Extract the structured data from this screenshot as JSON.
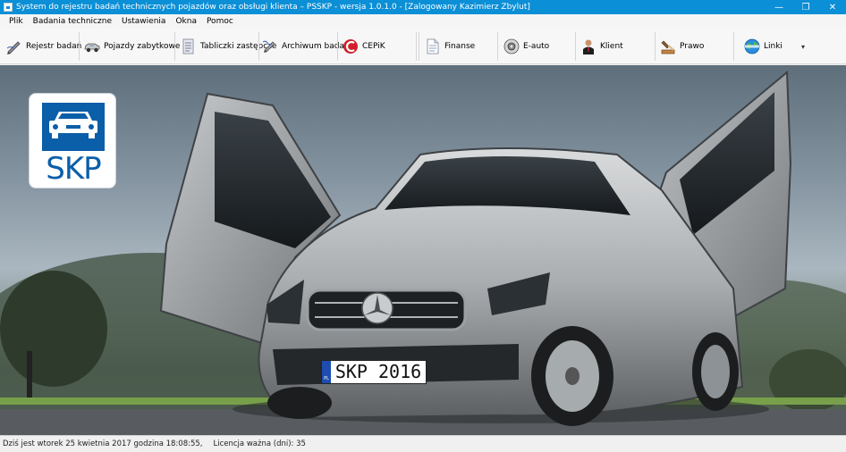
{
  "window": {
    "title": "System do rejestru badań technicznych pojazdów oraz obsługi klienta – PSSKP - wersja 1.0.1.0 - [Zalogowany Kazimierz Zbylut]",
    "buttons": {
      "minimize": "—",
      "restore": "❐",
      "close": "✕"
    }
  },
  "menu": {
    "items": [
      "Plik",
      "Badania techniczne",
      "Ustawienia",
      "Okna",
      "Pomoc"
    ]
  },
  "toolbar": {
    "buttons": [
      {
        "label": "Rejestr badań",
        "icon": "pen-icon"
      },
      {
        "label": "Pojazdy zabytkowe",
        "icon": "vintage-car-icon"
      },
      {
        "label": "Tabliczki zastępcze",
        "icon": "plates-icon"
      },
      {
        "label": "Archiwum badań",
        "icon": "archive-icon"
      },
      {
        "label": "CEPiK",
        "icon": "cepik-icon"
      },
      {
        "label": "Finanse",
        "icon": "document-icon"
      },
      {
        "label": "E-auto",
        "icon": "disc-icon"
      },
      {
        "label": "Klient",
        "icon": "person-icon"
      },
      {
        "label": "Prawo",
        "icon": "law-icon"
      },
      {
        "label": "Linki",
        "icon": "globe-icon"
      }
    ],
    "more_glyph": "▾"
  },
  "content": {
    "logo_text": "SKP",
    "plate_text": "SKP 2016",
    "plate_country": "PL"
  },
  "status": {
    "date_text": "Dziś jest wtorek 25 kwietnia 2017 godzina 18:08:55,",
    "license_text": "Licencja ważna (dni): 35"
  },
  "colors": {
    "titlebar": "#0b8fd6",
    "logo_blue": "#0b5ea8",
    "cepik_red": "#d0202a"
  }
}
